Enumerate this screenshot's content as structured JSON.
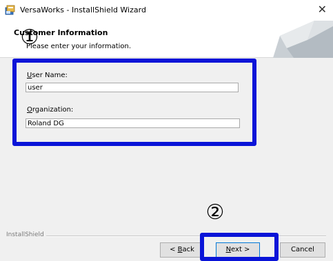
{
  "window": {
    "title": "VersaWorks - InstallShield Wizard",
    "icon": "installer-icon",
    "close_glyph": "✕"
  },
  "header": {
    "title": "Customer Information",
    "subtitle": "Please enter your information.",
    "art": "curled-page-graphic"
  },
  "form": {
    "user_name_label_first": "U",
    "user_name_label_rest": "ser Name:",
    "user_name_value": "user",
    "organization_label_first": "O",
    "organization_label_rest": "rganization:",
    "organization_value": "Roland DG"
  },
  "footer": {
    "brand": "InstallShield",
    "back_prefix": "< ",
    "back_first": "B",
    "back_rest": "ack",
    "next_first": "N",
    "next_rest": "ext >",
    "cancel": "Cancel"
  },
  "callouts": {
    "step1": "①",
    "step2": "②",
    "highlight_color": "#0a14d8"
  }
}
